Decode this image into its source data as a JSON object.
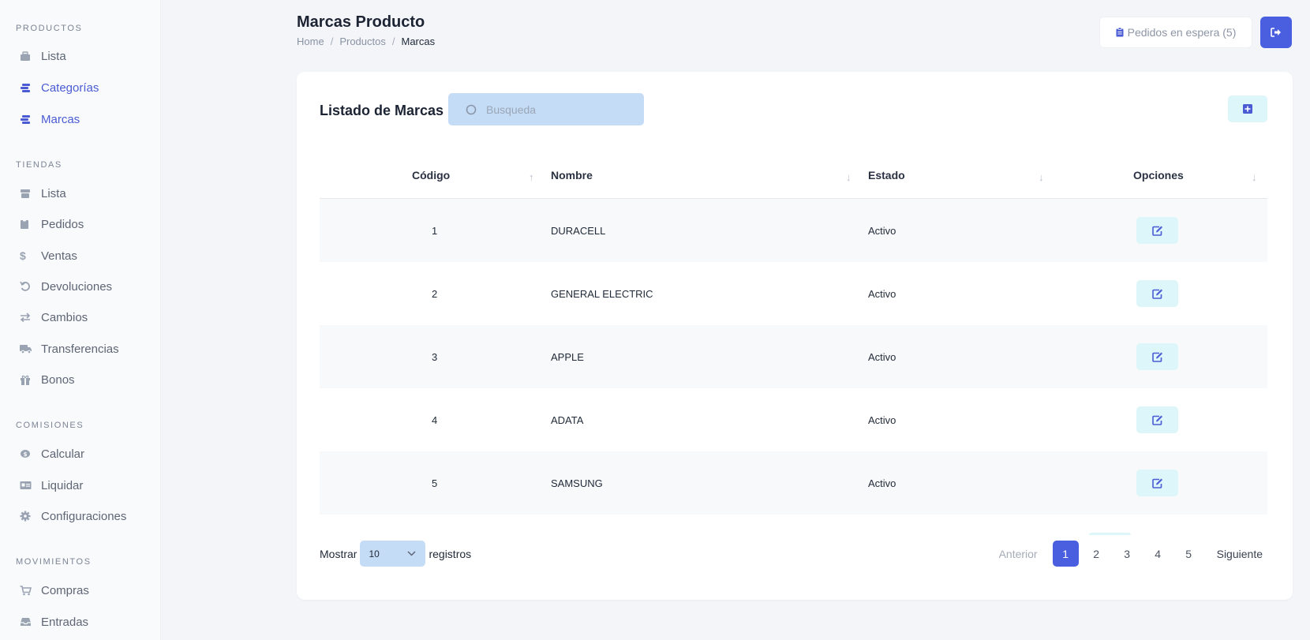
{
  "sidebar": {
    "sections": [
      {
        "title": "PRODUCTOS",
        "items": [
          {
            "label": "Lista",
            "icon": "box-icon"
          },
          {
            "label": "Categorías",
            "icon": "layers-icon"
          },
          {
            "label": "Marcas",
            "icon": "layers-icon"
          }
        ]
      },
      {
        "title": "TIENDAS",
        "items": [
          {
            "label": "Lista",
            "icon": "store-icon"
          },
          {
            "label": "Pedidos",
            "icon": "clipboard-icon"
          },
          {
            "label": "Ventas",
            "icon": "dollar-icon"
          },
          {
            "label": "Devoluciones",
            "icon": "undo-icon"
          },
          {
            "label": "Cambios",
            "icon": "exchange-icon"
          },
          {
            "label": "Transferencias",
            "icon": "truck-icon"
          },
          {
            "label": "Bonos",
            "icon": "gift-icon"
          }
        ]
      },
      {
        "title": "COMISIONES",
        "items": [
          {
            "label": "Calcular",
            "icon": "coins-icon"
          },
          {
            "label": "Liquidar",
            "icon": "id-card-icon"
          },
          {
            "label": "Configuraciones",
            "icon": "gear-icon"
          }
        ]
      },
      {
        "title": "MOVIMIENTOS",
        "items": [
          {
            "label": "Compras",
            "icon": "cart-icon"
          },
          {
            "label": "Entradas",
            "icon": "inbox-icon"
          }
        ]
      }
    ]
  },
  "header": {
    "title": "Marcas Producto",
    "breadcrumb": [
      "Home",
      "Productos",
      "Marcas"
    ],
    "pending_button": "Pedidos en espera (5)"
  },
  "card": {
    "title": "Listado de Marcas",
    "search_placeholder": "Busqueda",
    "columns": [
      "Código",
      "Nombre",
      "Estado",
      "Opciones"
    ],
    "rows": [
      {
        "code": "1",
        "name": "DURACELL",
        "status": "Activo"
      },
      {
        "code": "2",
        "name": "GENERAL ELECTRIC",
        "status": "Activo"
      },
      {
        "code": "3",
        "name": "APPLE",
        "status": "Activo"
      },
      {
        "code": "4",
        "name": "ADATA",
        "status": "Activo"
      },
      {
        "code": "5",
        "name": "SAMSUNG",
        "status": "Activo"
      }
    ],
    "show_label": "Mostrar",
    "page_size": "10",
    "records_label": "registros",
    "pagination": {
      "prev": "Anterior",
      "pages": [
        "1",
        "2",
        "3",
        "4",
        "5"
      ],
      "current": "1",
      "next": "Siguiente"
    }
  },
  "colors": {
    "accent": "#4a5ee0",
    "sidebar_active": "#4a5bd4",
    "input_bg": "#c5dcf6",
    "icon_button_bg": "#dcf6fa"
  }
}
